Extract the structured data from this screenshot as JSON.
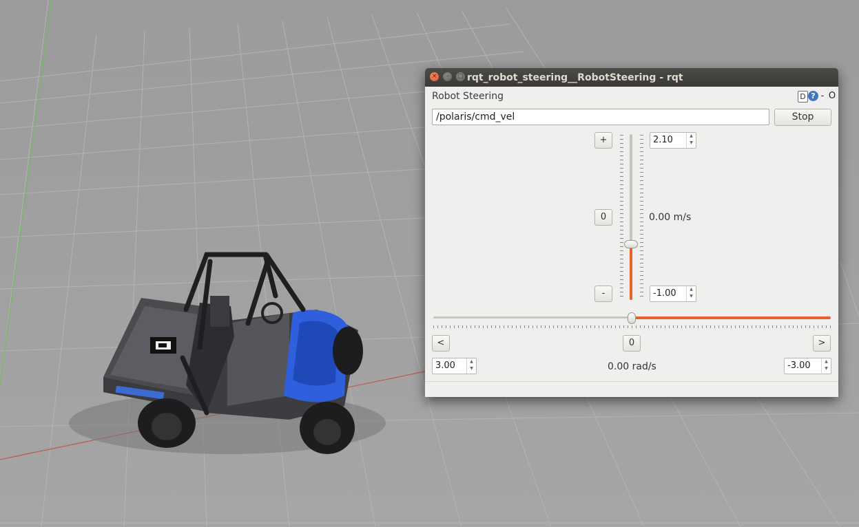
{
  "window": {
    "title": "rqt_robot_steering__RobotSteering - rqt",
    "controls": {
      "close": "×",
      "minimize": "–",
      "maximize": "□"
    }
  },
  "plugin": {
    "title": "Robot Steering",
    "icons": {
      "detach": "D",
      "help": "?",
      "minimize": "-",
      "close": "O"
    }
  },
  "topic": {
    "value": "/polaris/cmd_vel"
  },
  "stop_label": "Stop",
  "linear": {
    "plus_label": "+",
    "zero_label": "0",
    "minus_label": "-",
    "max_value": "2.10",
    "min_value": "-1.00",
    "readout": "0.00 m/s",
    "slider_fraction": 0.32
  },
  "angular": {
    "left_label": "<",
    "zero_label": "0",
    "right_label": ">",
    "max_value": "3.00",
    "min_value": "-3.00",
    "readout": "0.00 rad/s",
    "slider_fraction": 0.5
  },
  "colors": {
    "accent": "#e8602c",
    "titlebar": "#3f3e3a",
    "window_bg": "#f0efed",
    "vehicle_blue": "#2f5fdc"
  }
}
